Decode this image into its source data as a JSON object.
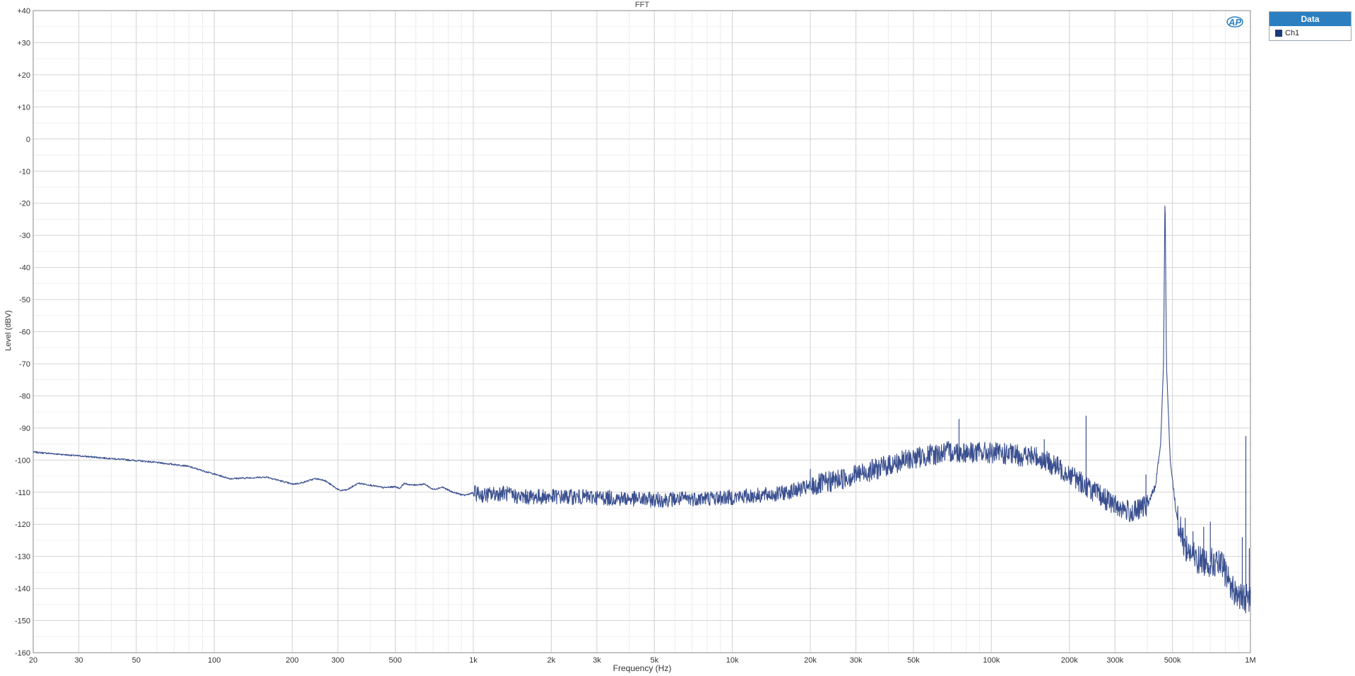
{
  "chart_data": {
    "type": "line",
    "title": "FFT",
    "xlabel": "Frequency (Hz)",
    "ylabel": "Level (dBV)",
    "xscale": "log",
    "xlim": [
      20,
      1000000
    ],
    "ylim": [
      -160,
      40
    ],
    "grid": true,
    "legend_placement": "top-right, outside plot",
    "legend_title": "Data",
    "x_ticks": [
      {
        "value": 20,
        "label": "20"
      },
      {
        "value": 30,
        "label": "30"
      },
      {
        "value": 50,
        "label": "50"
      },
      {
        "value": 100,
        "label": "100"
      },
      {
        "value": 200,
        "label": "200"
      },
      {
        "value": 300,
        "label": "300"
      },
      {
        "value": 500,
        "label": "500"
      },
      {
        "value": 1000,
        "label": "1k"
      },
      {
        "value": 2000,
        "label": "2k"
      },
      {
        "value": 3000,
        "label": "3k"
      },
      {
        "value": 5000,
        "label": "5k"
      },
      {
        "value": 10000,
        "label": "10k"
      },
      {
        "value": 20000,
        "label": "20k"
      },
      {
        "value": 30000,
        "label": "30k"
      },
      {
        "value": 50000,
        "label": "50k"
      },
      {
        "value": 100000,
        "label": "100k"
      },
      {
        "value": 200000,
        "label": "200k"
      },
      {
        "value": 300000,
        "label": "300k"
      },
      {
        "value": 500000,
        "label": "500k"
      },
      {
        "value": 1000000,
        "label": "1M"
      }
    ],
    "y_ticks": [
      {
        "value": 40,
        "label": "+40"
      },
      {
        "value": 30,
        "label": "+30"
      },
      {
        "value": 20,
        "label": "+20"
      },
      {
        "value": 10,
        "label": "+10"
      },
      {
        "value": 0,
        "label": "0"
      },
      {
        "value": -10,
        "label": "-10"
      },
      {
        "value": -20,
        "label": "-20"
      },
      {
        "value": -30,
        "label": "-30"
      },
      {
        "value": -40,
        "label": "-40"
      },
      {
        "value": -50,
        "label": "-50"
      },
      {
        "value": -60,
        "label": "-60"
      },
      {
        "value": -70,
        "label": "-70"
      },
      {
        "value": -80,
        "label": "-80"
      },
      {
        "value": -90,
        "label": "-90"
      },
      {
        "value": -100,
        "label": "-100"
      },
      {
        "value": -110,
        "label": "-110"
      },
      {
        "value": -120,
        "label": "-120"
      },
      {
        "value": -130,
        "label": "-130"
      },
      {
        "value": -140,
        "label": "-140"
      },
      {
        "value": -150,
        "label": "-150"
      },
      {
        "value": -160,
        "label": "-160"
      }
    ],
    "series": [
      {
        "name": "Ch1",
        "color": "#3a4f8f",
        "points": [
          [
            20,
            -97.5
          ],
          [
            30,
            -98.7
          ],
          [
            56,
            -100.5
          ],
          [
            78,
            -101.8
          ],
          [
            115,
            -105.8
          ],
          [
            160,
            -105.3
          ],
          [
            200,
            -107.5
          ],
          [
            215,
            -107.2
          ],
          [
            245,
            -105.8
          ],
          [
            265,
            -106.2
          ],
          [
            305,
            -109.5
          ],
          [
            325,
            -109.3
          ],
          [
            360,
            -107.2
          ],
          [
            400,
            -107.8
          ],
          [
            450,
            -108.6
          ],
          [
            500,
            -108.3
          ],
          [
            520,
            -108.8
          ],
          [
            540,
            -107.3
          ],
          [
            580,
            -107.8
          ],
          [
            650,
            -107.5
          ],
          [
            700,
            -109.2
          ],
          [
            760,
            -108.4
          ],
          [
            820,
            -109.8
          ],
          [
            920,
            -111.0
          ],
          [
            1000,
            -110.2
          ],
          [
            1100,
            -111.0
          ],
          [
            1300,
            -110.2
          ],
          [
            1500,
            -111.5
          ],
          [
            2000,
            -111.4
          ],
          [
            3000,
            -111.6
          ],
          [
            5000,
            -112.4
          ],
          [
            7000,
            -112.0
          ],
          [
            10000,
            -111.6
          ],
          [
            15000,
            -110.6
          ],
          [
            20000,
            -108.4
          ],
          [
            30000,
            -104.6
          ],
          [
            50000,
            -99.4
          ],
          [
            70000,
            -97.3
          ],
          [
            100000,
            -97.8
          ],
          [
            150000,
            -99.0
          ],
          [
            200000,
            -104.2
          ],
          [
            250000,
            -110.0
          ],
          [
            300000,
            -114.0
          ],
          [
            350000,
            -116.5
          ],
          [
            400000,
            -114.0
          ],
          [
            430000,
            -108.0
          ],
          [
            450000,
            -95.0
          ],
          [
            462000,
            -70.0
          ],
          [
            468000,
            -15.0
          ],
          [
            474000,
            -70.0
          ],
          [
            490000,
            -100.0
          ],
          [
            520000,
            -118.0
          ],
          [
            560000,
            -127.0
          ],
          [
            620000,
            -131.0
          ],
          [
            700000,
            -131.8
          ],
          [
            780000,
            -133.0
          ],
          [
            850000,
            -140.0
          ],
          [
            920000,
            -143.0
          ],
          [
            1000000,
            -143.0
          ]
        ],
        "spurs": [
          [
            20000,
            -102.8
          ],
          [
            75000,
            -87.2
          ],
          [
            160000,
            -93.5
          ],
          [
            232000,
            -86.2
          ],
          [
            395000,
            -104.5
          ],
          [
            560000,
            -118.0
          ],
          [
            600000,
            -122.2
          ],
          [
            660000,
            -120.8
          ],
          [
            700000,
            -119.2
          ],
          [
            790000,
            -134.0
          ],
          [
            930000,
            -124.0
          ],
          [
            960000,
            -92.5
          ],
          [
            990000,
            -127.5
          ]
        ]
      }
    ]
  },
  "legend": {
    "title": "Data",
    "items": [
      {
        "label": "Ch1",
        "color": "#1b3a7a"
      }
    ]
  },
  "logo": {
    "text": "AP"
  }
}
